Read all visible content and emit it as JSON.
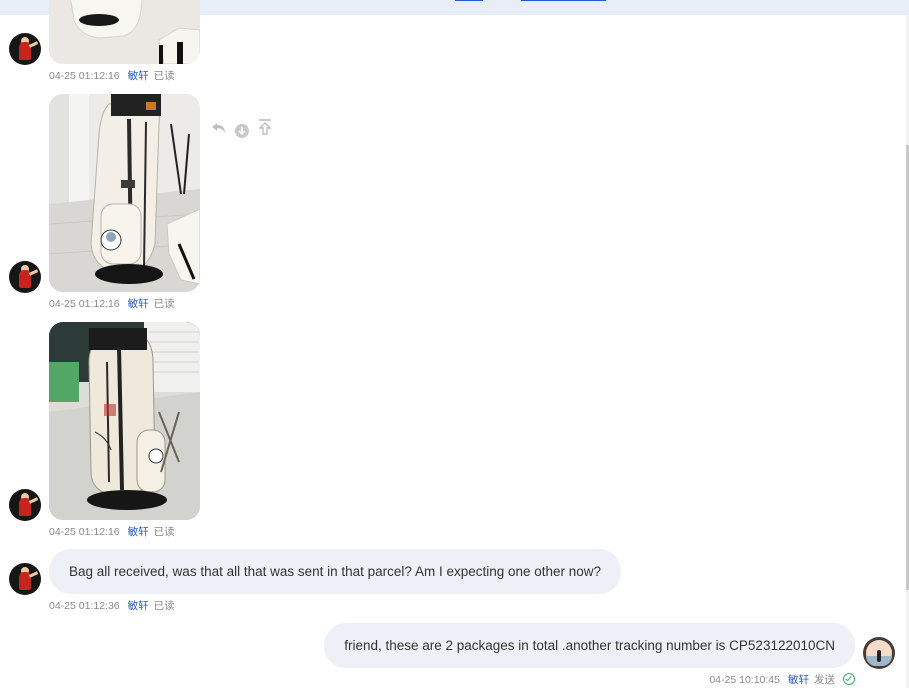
{
  "sender": {
    "name": "敏轩",
    "read_status": "已读"
  },
  "messages": [
    {
      "type": "image",
      "time": "04-25 01:12:16",
      "subject": "golf stand bag photo (partially visible)"
    },
    {
      "type": "image",
      "time": "04-25 01:12:16",
      "subject": "white golf stand bag with logo"
    },
    {
      "type": "image",
      "time": "04-25 01:12:16",
      "subject": "white golf stand bag on gray floor"
    },
    {
      "type": "text",
      "time": "04-25 01:12:36",
      "text": "Bag all received, was that all that was sent in that parcel? Am I expecting one other now?"
    }
  ],
  "outgoing": {
    "text": "friend, these are 2 packages in total .another tracking number is CP523122010CN",
    "time": "04-25 10:10:45",
    "name": "敏轩",
    "status": "发送"
  },
  "hover_actions": [
    {
      "icon": "reply-icon"
    },
    {
      "icon": "download-icon"
    },
    {
      "icon": "share-icon"
    }
  ],
  "colors": {
    "accent": "#2b59c3",
    "bubble": "#edf0f6",
    "read_ok": "#34b267"
  }
}
